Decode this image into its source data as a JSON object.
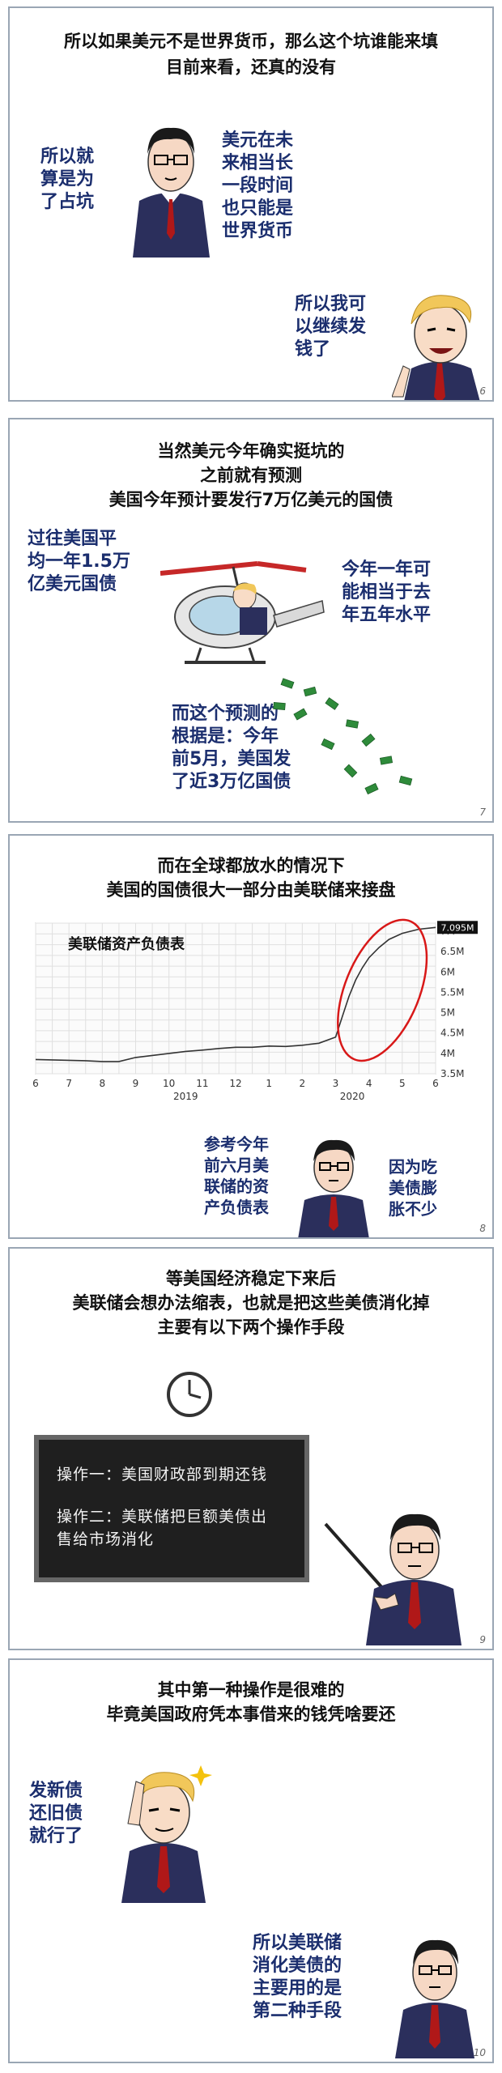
{
  "panels": [
    {
      "number": "6",
      "header": [
        "所以如果美元不是世界货币，那么这个坑谁能来填",
        "目前来看，还真的没有"
      ],
      "left_text": [
        "所以就",
        "算是为",
        "了占坑"
      ],
      "mid_text": [
        "美元在未",
        "来相当长",
        "一段时间",
        "也只能是",
        "世界货币"
      ],
      "right_text": [
        "所以我可",
        "以继续发",
        "钱了"
      ]
    },
    {
      "number": "7",
      "header": [
        "当然美元今年确实挺坑的",
        "之前就有预测",
        "美国今年预计要发行7万亿美元的国债"
      ],
      "left_text": [
        "过往美国平",
        "均一年1.5万",
        "亿美元国债"
      ],
      "right_text": [
        "今年一年可",
        "能相当于去",
        "年五年水平"
      ],
      "bottom_text": [
        "而这个预测的",
        "根据是：今年",
        "前5月，美国发",
        "了近3万亿国债"
      ]
    },
    {
      "number": "8",
      "header": [
        "而在全球都放水的情况下",
        "美国的国债很大一部分由美联储来接盘"
      ],
      "left_text": [
        "参考今年",
        "前六月美",
        "联储的资",
        "产负债表"
      ],
      "right_text": [
        "因为吃",
        "美债膨",
        "胀不少"
      ]
    },
    {
      "number": "9",
      "header": [
        "等美国经济稳定下来后",
        "美联储会想办法缩表，也就是把这些美债消化掉",
        "主要有以下两个操作手段"
      ],
      "board": [
        "操作一：美国财政部到期还钱",
        "操作二：美联储把巨额美债出",
        "售给市场消化"
      ]
    },
    {
      "number": "10",
      "header": [
        "其中第一种操作是很难的",
        "毕竟美国政府凭本事借来的钱凭啥要还"
      ],
      "left_text": [
        "发新债",
        "还旧债",
        "就行了"
      ],
      "right_text": [
        "所以美联储",
        "消化美债的",
        "主要用的是",
        "第二种手段"
      ]
    }
  ],
  "chart_data": {
    "type": "line",
    "title": "美联储资产负债表",
    "x_tick_labels": [
      "6",
      "7",
      "8",
      "9",
      "10",
      "11",
      "12",
      "1",
      "2",
      "3",
      "4",
      "5",
      "6"
    ],
    "year_labels": [
      "2019",
      "2020"
    ],
    "y_tick_labels": [
      "3.5M",
      "4M",
      "4.5M",
      "5M",
      "5.5M",
      "6M",
      "6.5M",
      "7M"
    ],
    "ylim": [
      3.5,
      7.2
    ],
    "last_value_label": "7.095M",
    "series": [
      {
        "x": [
          0,
          0.5,
          1,
          1.5,
          2,
          2.5,
          3,
          3.5,
          4,
          4.5,
          5,
          5.5,
          6,
          6.5,
          7,
          7.5,
          8,
          8.5,
          9,
          9.2,
          9.4,
          9.6,
          9.8,
          10,
          10.3,
          10.6,
          11,
          11.5,
          12
        ],
        "values": [
          3.85,
          3.84,
          3.83,
          3.82,
          3.8,
          3.8,
          3.9,
          3.95,
          4.0,
          4.05,
          4.08,
          4.12,
          4.15,
          4.15,
          4.18,
          4.17,
          4.2,
          4.25,
          4.4,
          4.9,
          5.4,
          5.8,
          6.1,
          6.35,
          6.6,
          6.8,
          6.95,
          7.05,
          7.095
        ]
      }
    ],
    "grid": true,
    "highlight_color": "#d81818",
    "line_color": "#333333"
  },
  "colors": {
    "text_blue": "#1b2e6e",
    "panel_border": "#9aa6b4",
    "suit": "#2b2f5c",
    "tie": "#b01818",
    "hair_trump": "#f1c75a",
    "money": "#2e8b3a"
  }
}
